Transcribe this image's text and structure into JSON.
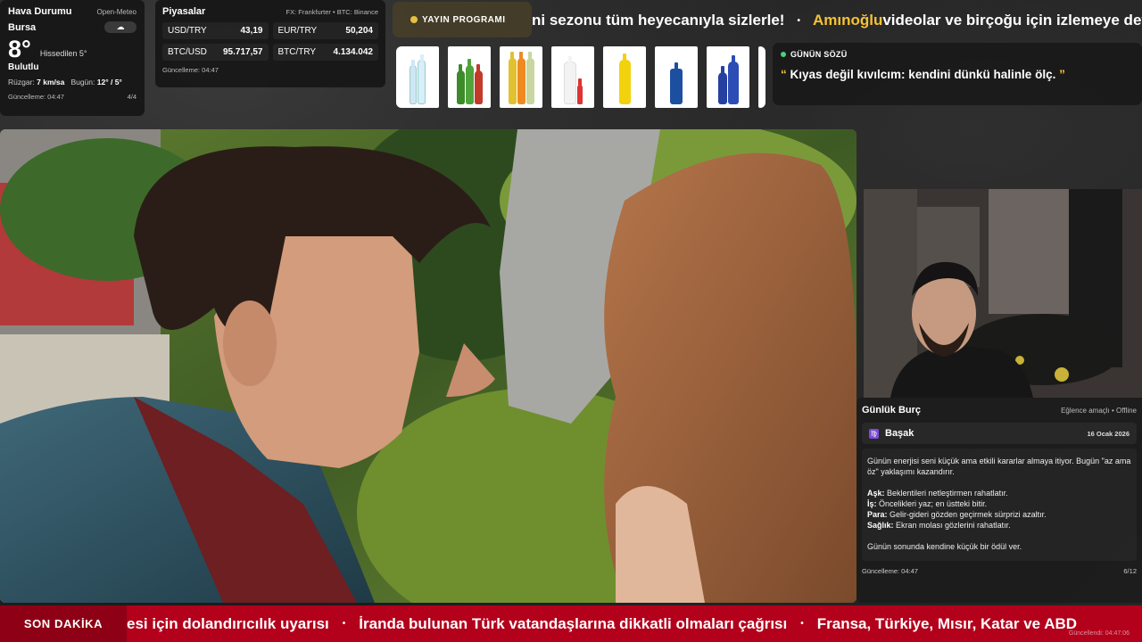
{
  "weather": {
    "title": "Hava Durumu",
    "source": "Open-Meteo",
    "city": "Bursa",
    "condition_icon": "cloud-icon",
    "condition_icon_glyph": "☁",
    "temperature": "8°",
    "feels_like": "Hissedilen 5°",
    "condition": "Bulutlu",
    "wind_label": "Rüzgar:",
    "wind_value": "7 km/sa",
    "today_label": "Bugün:",
    "today_value": "12° / 5°",
    "updated": "Güncelleme: 04:47",
    "page": "4/4"
  },
  "markets": {
    "title": "Piyasalar",
    "source": "FX: Frankfurter • BTC: Binance",
    "items": [
      {
        "label": "USD/TRY",
        "value": "43,19"
      },
      {
        "label": "EUR/TRY",
        "value": "50,204"
      },
      {
        "label": "BTC/USD",
        "value": "95.717,57"
      },
      {
        "label": "BTC/TRY",
        "value": "4.134.042"
      }
    ],
    "updated": "Güncelleme: 04:47"
  },
  "schedule_button": {
    "label": "YAYIN PROGRAMI"
  },
  "top_ticker": {
    "segment1": "ni sezonu tüm heyecanıyla sizlerle!",
    "sep": "•",
    "segment2_highlight": "Amınoğlu",
    "segment2_rest": " videolar ve birçoğu için izlemeye devam"
  },
  "products": [
    {
      "name": "product-water-bottles"
    },
    {
      "name": "product-green-soda-bottles"
    },
    {
      "name": "product-fruit-soda-bottles"
    },
    {
      "name": "product-milk-bottle"
    },
    {
      "name": "product-yellow-bottle"
    },
    {
      "name": "product-blue-can"
    },
    {
      "name": "product-blue-bottles"
    },
    {
      "name": "product-orange-bottles"
    }
  ],
  "quote": {
    "label": "GÜNÜN SÖZÜ",
    "open_quote": "“",
    "text": " Kıyas değil kıvılcım: kendini dünkü halinle ölç. ",
    "close_quote": "”"
  },
  "horoscope": {
    "title": "Günlük Burç",
    "tag": "Eğlence amaçlı • Offline",
    "sign_glyph": "♍",
    "sign": "Başak",
    "date": "16 Ocak 2026",
    "intro": "Günün enerjisi seni küçük ama etkili kararlar almaya itiyor. Bugün \"az ama öz\" yaklaşımı kazandırır.",
    "lines": [
      {
        "key": "Aşk:",
        "text": " Beklentileri netleştirmen rahatlatır."
      },
      {
        "key": "İş:",
        "text": " Öncelikleri yaz; en üstteki bitir."
      },
      {
        "key": "Para:",
        "text": " Gelir-gideri gözden geçirmek sürprizi azaltır."
      },
      {
        "key": "Sağlık:",
        "text": " Ekran molası gözlerini rahatlatır."
      }
    ],
    "closing": "Günün sonunda kendine küçük bir ödül ver.",
    "updated": "Güncelleme: 04:47",
    "page": "6/12"
  },
  "breaking": {
    "label": "SON DAKİKA",
    "items": [
      "esi için dolandırıcılık uyarısı",
      "İranda bulunan Türk vatandaşlarına dikkatli olmaları çağrısı",
      "Fransa, Türkiye, Mısır, Katar ve ABD"
    ],
    "sep": "•",
    "updated": "Güncellendi: 04:47:06"
  }
}
